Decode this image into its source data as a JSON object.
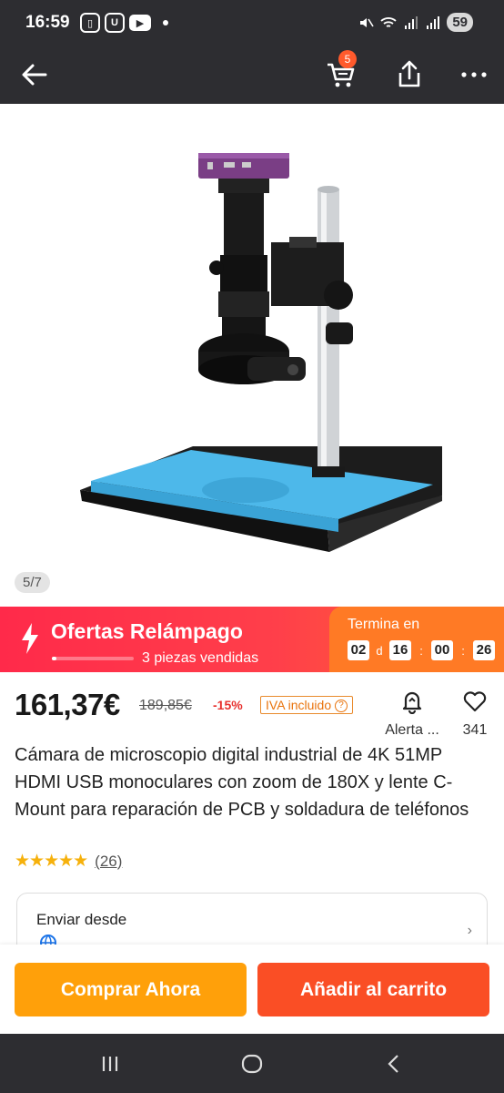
{
  "status_bar": {
    "time": "16:59",
    "battery": "59"
  },
  "top_bar": {
    "cart_count": "5"
  },
  "gallery": {
    "counter": "5/7"
  },
  "flash_deal": {
    "title": "Ofertas Relámpago",
    "sold_text": "3 piezas vendidas",
    "sold_progress": 0.06,
    "ends_label": "Termina en",
    "days": "02",
    "days_sep": "d",
    "hours": "16",
    "minutes": "00",
    "seconds": "26",
    "colon": ":"
  },
  "price": {
    "current": "161,37€",
    "original": "189,85€",
    "discount": "-15%",
    "vat_label": "IVA incluido"
  },
  "actions": {
    "alert_label": "Alerta ...",
    "wishlist_count": "341"
  },
  "product": {
    "title": "Cámara de microscopio digital industrial de 4K 51MP HDMI USB monoculares con zoom de 180X y lente C-Mount para reparación de PCB y soldadura de teléfonos",
    "stars": "★★★★★",
    "reviews": "(26)"
  },
  "shipping": {
    "label": "Enviar desde"
  },
  "buttons": {
    "buy_now": "Comprar Ahora",
    "add_to_cart": "Añadir al carrito"
  },
  "colors": {
    "flash_red": "#ff2a4a",
    "flash_orange": "#ff7a25",
    "buy_button": "#ffa00a",
    "cart_button": "#fa4e25",
    "star": "#f6b10c"
  }
}
